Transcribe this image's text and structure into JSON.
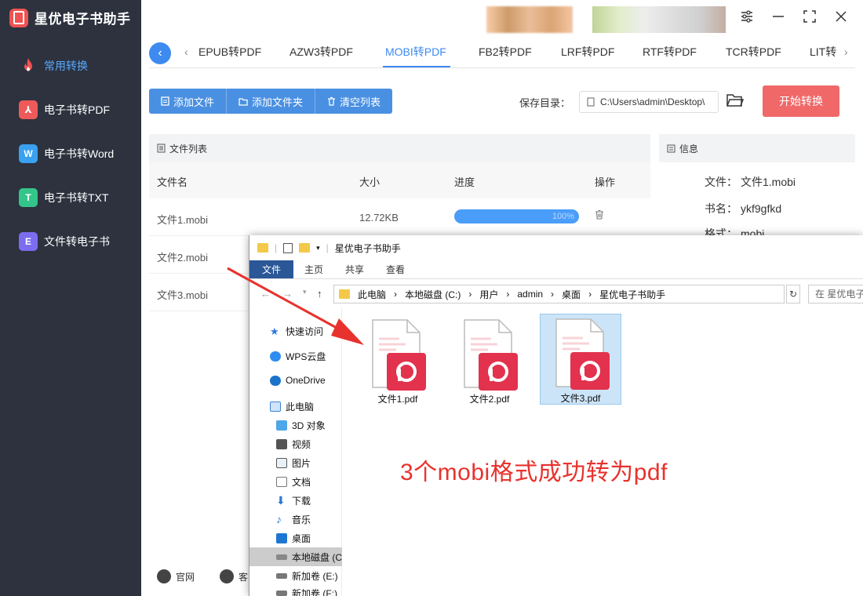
{
  "app": {
    "title": "星优电子书助手"
  },
  "sidebar": {
    "items": [
      {
        "label": "常用转换",
        "icon": "fire-icon",
        "color": "#f05252"
      },
      {
        "label": "电子书转PDF",
        "icon": "pdf-icon",
        "color": "#ee5a5a",
        "glyph": "⅄"
      },
      {
        "label": "电子书转Word",
        "icon": "word-icon",
        "color": "#3aa0f0",
        "glyph": "W"
      },
      {
        "label": "电子书转TXT",
        "icon": "txt-icon",
        "color": "#34c58a",
        "glyph": "T"
      },
      {
        "label": "文件转电子书",
        "icon": "ebook-icon",
        "color": "#7b6cf0",
        "glyph": "E"
      }
    ]
  },
  "tabs": [
    "EPUB转PDF",
    "AZW3转PDF",
    "MOBI转PDF",
    "FB2转PDF",
    "LRF转PDF",
    "RTF转PDF",
    "TCR转PDF",
    "LIT转"
  ],
  "toolbar": {
    "add_file": "添加文件",
    "add_folder": "添加文件夹",
    "clear_list": "清空列表",
    "save_label": "保存目录：",
    "save_path": "C:\\Users\\admin\\Desktop\\",
    "start": "开始转换"
  },
  "file_list": {
    "title": "文件列表",
    "columns": [
      "文件名",
      "大小",
      "进度",
      "操作"
    ],
    "rows": [
      {
        "name": "文件1.mobi",
        "size": "12.72KB",
        "progress": "100%"
      },
      {
        "name": "文件2.mobi"
      },
      {
        "name": "文件3.mobi"
      }
    ]
  },
  "info": {
    "title": "信息",
    "rows": [
      {
        "k": "文件：",
        "v": "文件1.mobi"
      },
      {
        "k": "书名：",
        "v": "ykf9gfkd"
      },
      {
        "k": "格式：",
        "v": "mobi"
      }
    ]
  },
  "footer": {
    "website": "官网",
    "service": "客"
  },
  "explorer": {
    "title": "星优电子书助手",
    "ribbon": [
      "文件",
      "主页",
      "共享",
      "查看"
    ],
    "path": [
      "此电脑",
      "本地磁盘 (C:)",
      "用户",
      "admin",
      "桌面",
      "星优电子书助手"
    ],
    "search_placeholder": "在 星优电子",
    "tree": [
      "快速访问",
      "WPS云盘",
      "OneDrive",
      "此电脑",
      "3D 对象",
      "视频",
      "图片",
      "文档",
      "下载",
      "音乐",
      "桌面",
      "本地磁盘 (C",
      "新加卷 (E:)",
      "新加卷 (F:)"
    ],
    "files": [
      "文件1.pdf",
      "文件2.pdf",
      "文件3.pdf"
    ]
  },
  "caption": "3个mobi格式成功转为pdf"
}
